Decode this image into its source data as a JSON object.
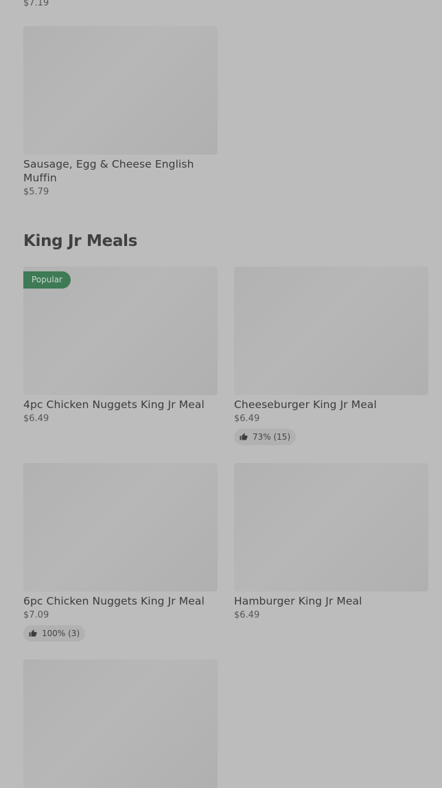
{
  "previous_item": {
    "price": "$7.19"
  },
  "breakfast": {
    "item": {
      "name": "Sausage, Egg & Cheese English Muffin",
      "price": "$5.79"
    }
  },
  "section": {
    "title": "King Jr Meals"
  },
  "items": [
    {
      "name": "4pc Chicken Nuggets King Jr Meal",
      "price": "$6.49",
      "badge": "Popular"
    },
    {
      "name": "Cheeseburger King Jr Meal",
      "price": "$6.49",
      "rating": "73% (15)"
    },
    {
      "name": "6pc Chicken Nuggets King Jr Meal",
      "price": "$7.09",
      "rating": "100% (3)"
    },
    {
      "name": "Hamburger King Jr Meal",
      "price": "$6.49"
    }
  ],
  "colors": {
    "background": "#bcbcbc",
    "image_placeholder": "#b3b3b3",
    "popular_badge": "#3d7a55"
  },
  "icons": {
    "rating": "thumbs-up-icon"
  }
}
